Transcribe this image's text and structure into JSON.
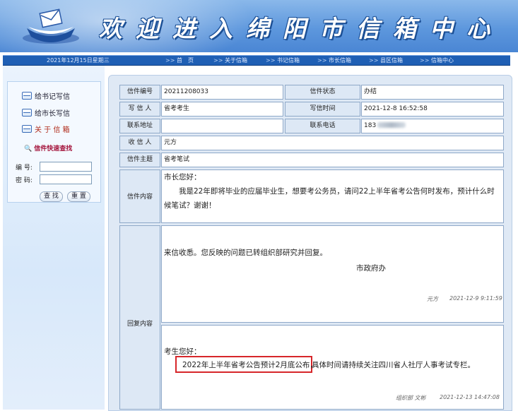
{
  "banner": {
    "title": "欢迎进入绵阳市信箱中心"
  },
  "navbar": {
    "date": "2021年12月15日星期三",
    "items": [
      "首　页",
      "关于信箱",
      "书记信箱",
      "市长信箱",
      "县区信箱",
      "信箱中心"
    ]
  },
  "sidebar": {
    "links": [
      "给书记写信",
      "给市长写信",
      "关 于 信 箱"
    ],
    "quick_search_title": "信件快速查找",
    "number_label": "编 号:",
    "password_label": "密 码:",
    "search_button": "查 找",
    "reset_button": "重 置"
  },
  "letter": {
    "number_label": "信件编号",
    "number": "20211208033",
    "status_label": "信件状态",
    "status": "办结",
    "writer_label": "写 信 人",
    "writer": "省考考生",
    "time_label": "写信时间",
    "time": "2021-12-8 16:52:58",
    "address_label": "联系地址",
    "address": "",
    "phone_label": "联系电话",
    "phone": "183",
    "recipient_label": "收 信 人",
    "recipient": "元方",
    "subject_label": "信件主题",
    "subject": "省考笔试",
    "content_label": "信件内容",
    "content_greeting": "市长您好：",
    "content_body": "我是22年即将毕业的应届毕业生，想要考公务员，请问22上半年省考公告何时发布，预计什么时候笔试？谢谢！"
  },
  "reply": {
    "label": "回复内容",
    "first": {
      "text": "来信收悉。您反映的问题已转组织部研究并回复。",
      "from": "市政府办",
      "signature": "元方",
      "time": "2021-12-9 9:11:59"
    },
    "second": {
      "greeting": "考生您好：",
      "highlight": "2022年上半年省考公告预计2月底公布，",
      "rest": "具体时间请持续关注四川省人社厅人事考试专栏。",
      "signature": "组织部 文彬",
      "time": "2021-12-13 14:47:08"
    },
    "highlight_color": "#d7262a"
  }
}
